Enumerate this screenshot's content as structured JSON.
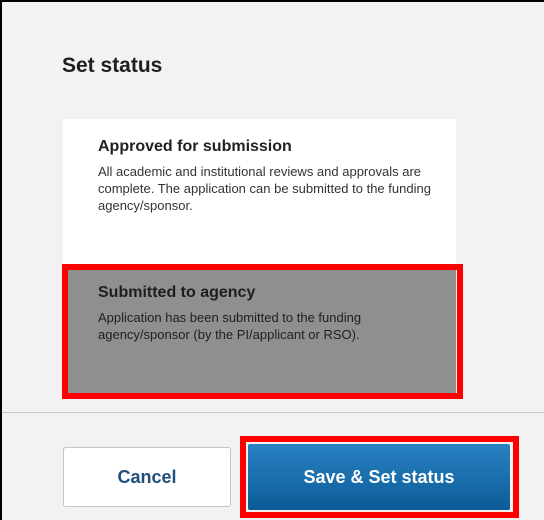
{
  "dialog": {
    "title": "Set status"
  },
  "statuses": [
    {
      "title": "Approved for submission",
      "description": "All academic and institutional reviews and approvals are complete. The application can be submitted to the funding agency/sponsor."
    },
    {
      "title": "Submitted to agency",
      "description": "Application has been submitted to the funding agency/sponsor (by the PI/applicant or RSO).",
      "selected": true
    }
  ],
  "footer": {
    "cancel_label": "Cancel",
    "save_label": "Save & Set status"
  },
  "colors": {
    "highlight": "#ff0000",
    "selected_bg": "#8f8f8f",
    "primary_button": "#0b5c97"
  }
}
